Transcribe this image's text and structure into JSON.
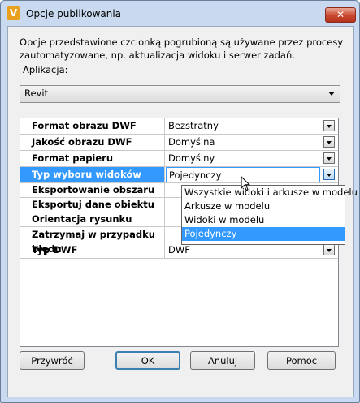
{
  "window": {
    "title": "Opcje publikowania",
    "close_label": "✕",
    "app_icon_glyph": "V"
  },
  "description": "Opcje przedstawione czcionką pogrubioną są używane przez procesy zautomatyzowane, np. aktualizacja widoku i serwer zadań.",
  "application": {
    "label": "Aplikacja:",
    "value": "Revit"
  },
  "properties": [
    {
      "label": "Format obrazu DWF",
      "value": "Bezstratny"
    },
    {
      "label": "Jakość obrazu DWF",
      "value": "Domyślna"
    },
    {
      "label": "Format papieru",
      "value": "Domyślny"
    },
    {
      "label": "Typ wyboru widoków",
      "value": "Pojedynczy"
    },
    {
      "label": "Eksportowanie obszaru",
      "value": ""
    },
    {
      "label": "Eksportuj dane obiektu",
      "value": ""
    },
    {
      "label": "Orientacja rysunku",
      "value": ""
    },
    {
      "label": "Zatrzymaj w przypadku błędu",
      "value": ""
    },
    {
      "label": "Typ DWF",
      "value": "DWF"
    }
  ],
  "dropdown_options": [
    "Wszystkie widoki i arkusze w modelu",
    "Arkusze w modelu",
    "Widoki w modelu",
    "Pojedynczy"
  ],
  "buttons": {
    "reset": "Przywróć",
    "ok": "OK",
    "cancel": "Anuluj",
    "help": "Pomoc"
  }
}
